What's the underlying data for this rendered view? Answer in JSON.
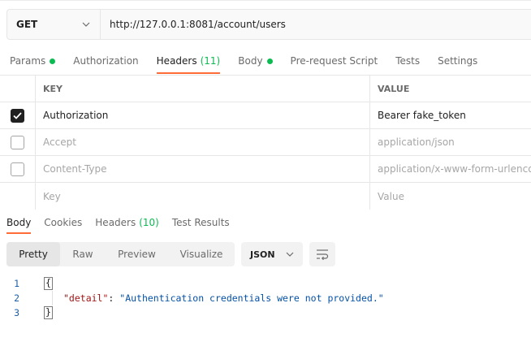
{
  "request": {
    "method": "GET",
    "url": "http://127.0.0.1:8081/account/users"
  },
  "request_tabs": [
    {
      "label": "Params",
      "dot": true
    },
    {
      "label": "Authorization"
    },
    {
      "label": "Headers",
      "count": "(11)",
      "active": true
    },
    {
      "label": "Body",
      "dot": true
    },
    {
      "label": "Pre-request Script"
    },
    {
      "label": "Tests"
    },
    {
      "label": "Settings"
    }
  ],
  "headers_table": {
    "col_key": "KEY",
    "col_value": "VALUE",
    "rows": [
      {
        "key": "Authorization",
        "value": "Bearer fake_token",
        "checked": true
      },
      {
        "key": "Accept",
        "value": "application/json",
        "checked": false
      },
      {
        "key": "Content-Type",
        "value": "application/x-www-form-urlenco",
        "checked": false
      }
    ],
    "placeholder_key": "Key",
    "placeholder_value": "Value"
  },
  "response_tabs": [
    {
      "label": "Body",
      "active": true
    },
    {
      "label": "Cookies"
    },
    {
      "label": "Headers",
      "count": "(10)"
    },
    {
      "label": "Test Results"
    }
  ],
  "view_modes": [
    "Pretty",
    "Raw",
    "Preview",
    "Visualize"
  ],
  "active_view": "Pretty",
  "format": "JSON",
  "code": {
    "line_numbers": [
      "1",
      "2",
      "3"
    ],
    "open_brace": "{",
    "close_brace": "}",
    "key": "\"detail\"",
    "colon": ":",
    "value": "\"Authentication credentials were not provided.\""
  },
  "colors": {
    "accent": "#ff6c37",
    "status_green": "#0cbb52"
  }
}
